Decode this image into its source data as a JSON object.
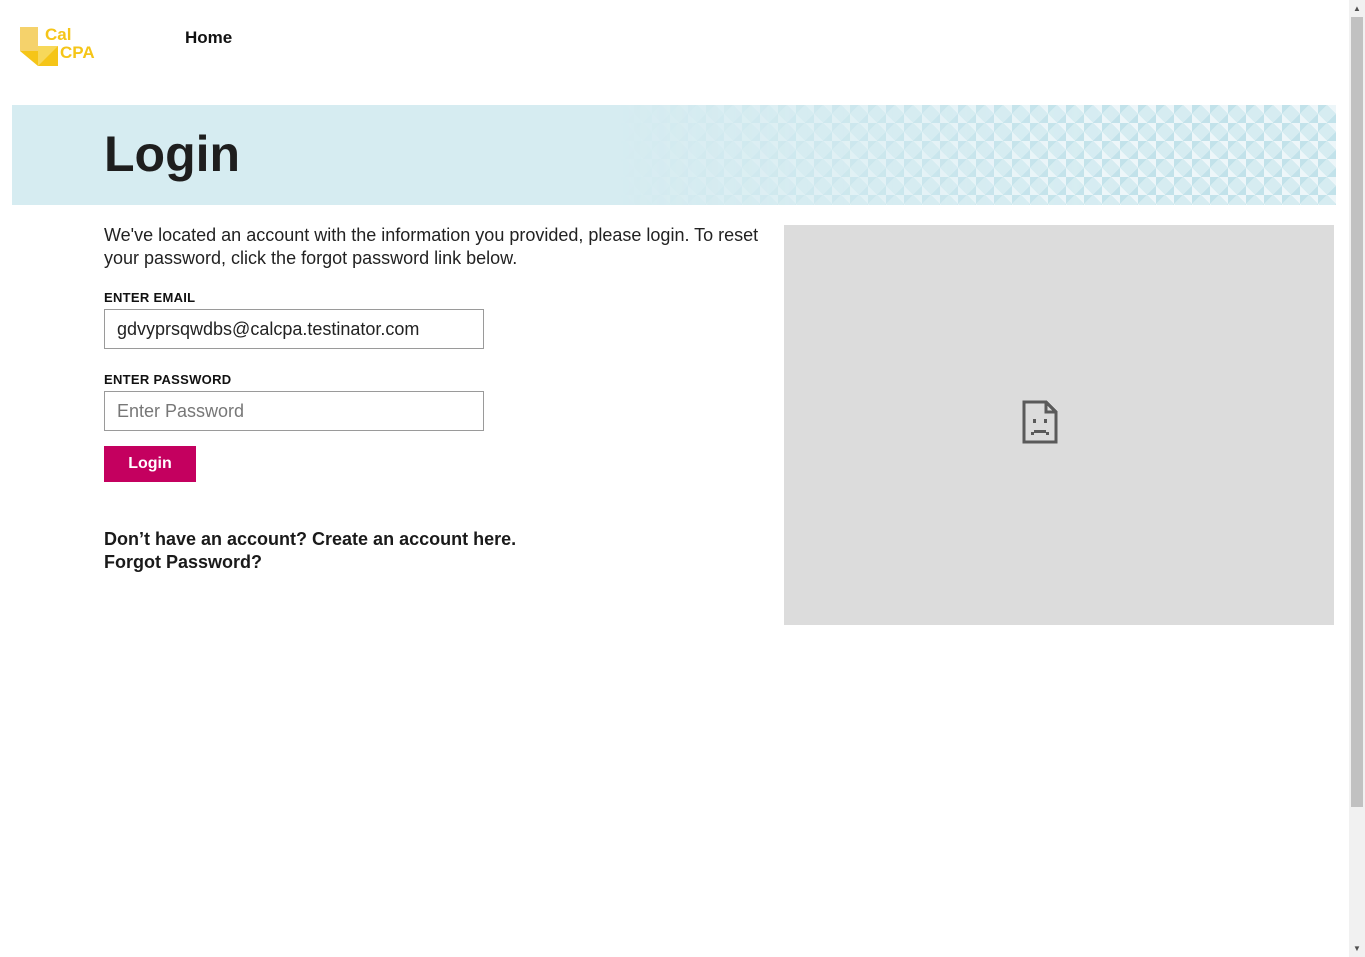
{
  "header": {
    "logo": {
      "line1": "Cal",
      "line2": "CPA",
      "color": "#f5c518"
    },
    "nav": {
      "home_label": "Home"
    }
  },
  "banner": {
    "title": "Login",
    "background_color": "#d6ecf1"
  },
  "form": {
    "intro_text": "We've located an account with the information you provided, please login. To reset your password, click the forgot password link below.",
    "email_label": "ENTER EMAIL",
    "email_value": "gdvyprsqwdbs@calcpa.testinator.com",
    "password_label": "ENTER PASSWORD",
    "password_placeholder": "Enter Password",
    "submit_label": "Login",
    "submit_color": "#c4005f"
  },
  "links": {
    "create_account": "Don’t have an account? Create an account here.",
    "forgot_password": "Forgot Password?"
  },
  "media": {
    "icon": "broken-image-icon",
    "background_color": "#dcdcdc"
  },
  "scrollbar": {
    "up_icon": "scroll-up-arrow-icon",
    "down_icon": "scroll-down-arrow-icon"
  }
}
